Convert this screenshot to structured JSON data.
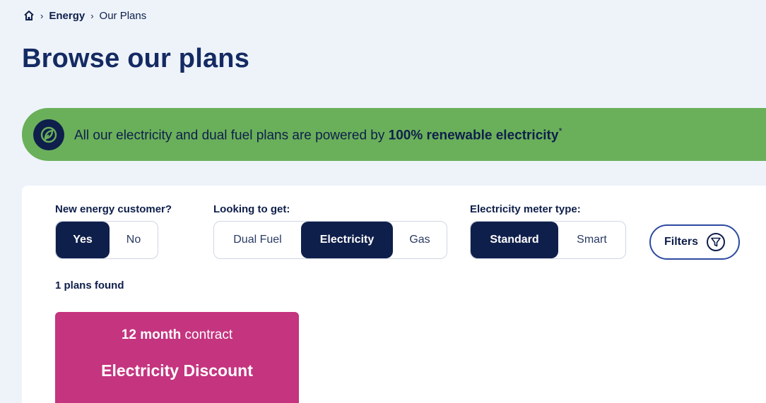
{
  "breadcrumb": {
    "home_icon": "home-icon",
    "items": [
      {
        "label": "Energy"
      },
      {
        "label": "Our Plans"
      }
    ]
  },
  "page": {
    "title": "Browse our plans"
  },
  "banner": {
    "icon": "leaf-icon",
    "text_prefix": "All our electricity and dual fuel plans are powered by ",
    "text_bold": "100% renewable electricity",
    "text_suffix": "*",
    "color": "#6ab05a"
  },
  "filters": {
    "new_customer": {
      "label": "New energy customer?",
      "options": [
        "Yes",
        "No"
      ],
      "selected": "Yes"
    },
    "looking_to_get": {
      "label": "Looking to get:",
      "options": [
        "Dual Fuel",
        "Electricity",
        "Gas"
      ],
      "selected": "Electricity"
    },
    "meter_type": {
      "label": "Electricity meter type:",
      "options": [
        "Standard",
        "Smart"
      ],
      "selected": "Standard"
    },
    "filters_button": {
      "label": "Filters",
      "icon": "funnel-icon"
    }
  },
  "results": {
    "count_text": "1 plans found"
  },
  "plans": [
    {
      "contract_bold": "12 month",
      "contract_rest": " contract",
      "name": "Electricity Discount",
      "color": "#c4347f"
    }
  ],
  "colors": {
    "navy": "#0f1f4b",
    "background": "#eef3fa",
    "accent_border": "#2d4aa0"
  }
}
